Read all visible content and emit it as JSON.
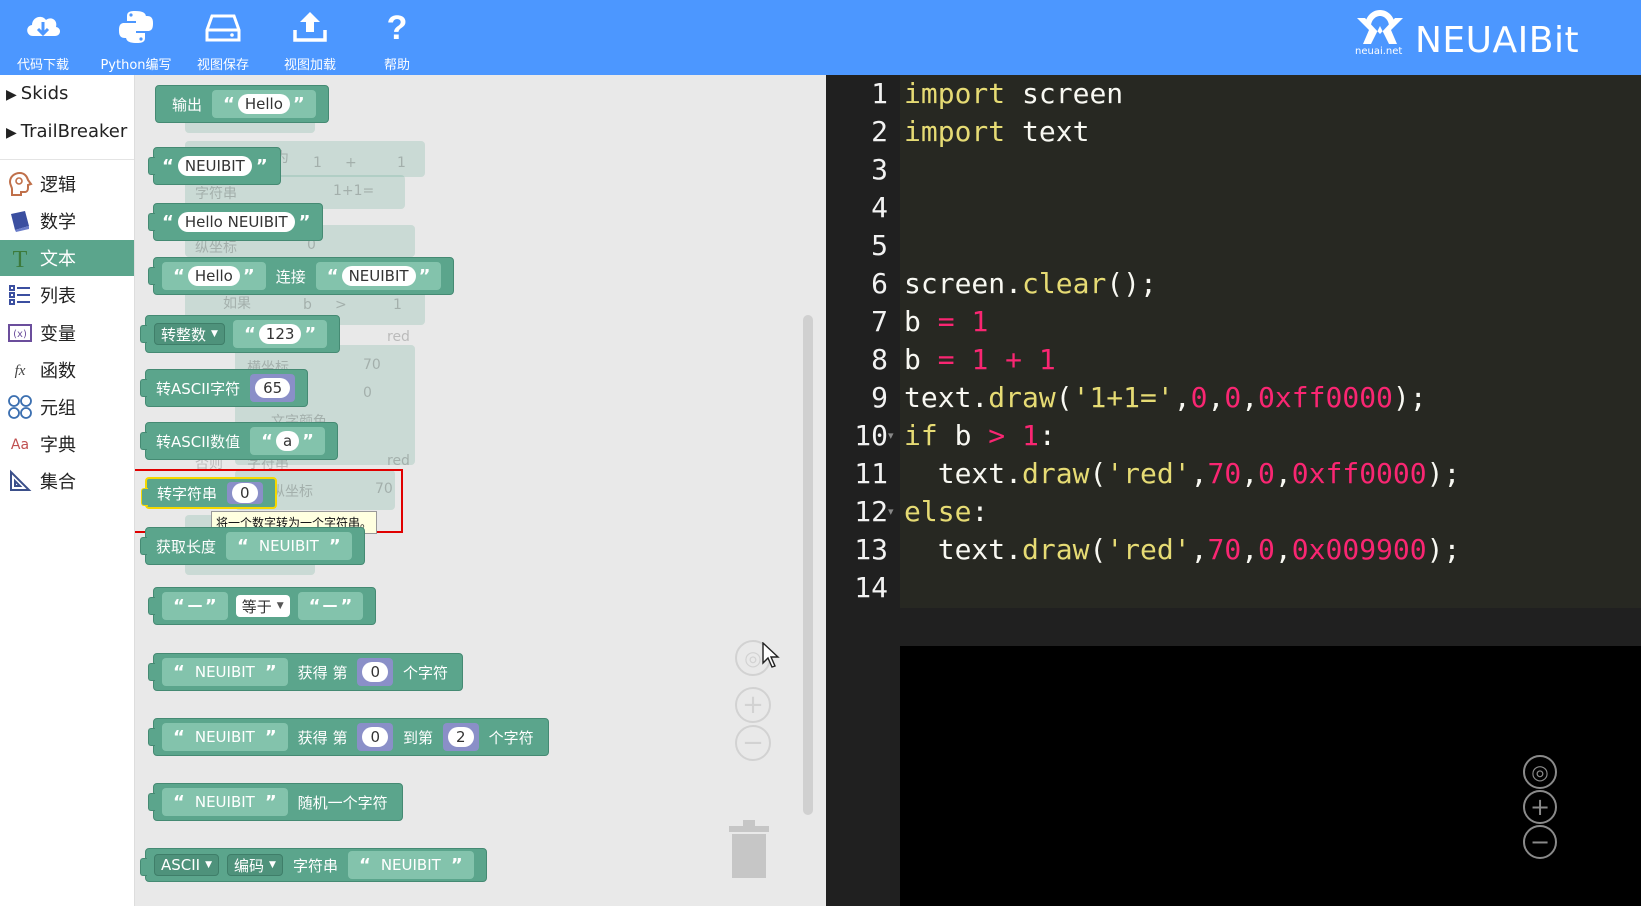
{
  "toolbar": {
    "buttons": [
      {
        "label": "代码下载",
        "icon": "cloud-download-icon"
      },
      {
        "label": "Python编写",
        "icon": "python-icon"
      },
      {
        "label": "视图保存",
        "icon": "drive-save-icon"
      },
      {
        "label": "视图加载",
        "icon": "upload-icon"
      },
      {
        "label": "帮助",
        "icon": "help-icon"
      }
    ],
    "brand_logo_text": "neuai.net",
    "brand_name": "NEUAIBit",
    "color": "#4c97ff"
  },
  "sidebar": {
    "extensions": [
      "Skids",
      "TrailBreaker"
    ],
    "categories": [
      {
        "label": "逻辑",
        "icon": "logic-head-icon",
        "active": false
      },
      {
        "label": "数学",
        "icon": "math-book-icon",
        "active": false
      },
      {
        "label": "文本",
        "icon": "text-t-icon",
        "active": true
      },
      {
        "label": "列表",
        "icon": "list-icon",
        "active": false
      },
      {
        "label": "变量",
        "icon": "variable-x-icon",
        "active": false
      },
      {
        "label": "函数",
        "icon": "function-fx-icon",
        "active": false
      },
      {
        "label": "元组",
        "icon": "tuple-circles-icon",
        "active": false
      },
      {
        "label": "字典",
        "icon": "dictionary-aa-icon",
        "active": false
      },
      {
        "label": "集合",
        "icon": "set-triangle-icon",
        "active": false
      }
    ],
    "active_color": "#5ba58c"
  },
  "flyout": {
    "print_block": {
      "label": "输出",
      "value": "Hello"
    },
    "str1": "NEUIBIT",
    "str2": "Hello NEUIBIT",
    "join": {
      "a": "Hello",
      "op": "连接",
      "b": "NEUIBIT"
    },
    "to_int": {
      "label": "转整数",
      "value": "123"
    },
    "to_ascii_char": {
      "label": "转ASCII字符",
      "value": "65"
    },
    "to_ascii_num": {
      "label": "转ASCII数值",
      "value": "a"
    },
    "to_str": {
      "label": "转字符串",
      "value": "0",
      "tooltip": "将一个数字转为一个字符串。"
    },
    "length": {
      "label": "获取长度",
      "value": "NEUIBIT"
    },
    "compare": {
      "op": "等于"
    },
    "char_at": {
      "s": "NEUIBIT",
      "l1": "获得 第",
      "n": "0",
      "l2": "个字符"
    },
    "substr": {
      "s": "NEUIBIT",
      "l1": "获得 第",
      "n1": "0",
      "l2": "到第",
      "n2": "2",
      "l3": "个字符"
    },
    "random_char": {
      "s": "NEUIBIT",
      "l": "随机一个字符"
    },
    "encode": {
      "enc": "ASCII",
      "op": "编码",
      "l": "字符串",
      "s": "NEUIBIT"
    },
    "ghost_labels": {
      "g1": "赋值为",
      "g2": "字符串",
      "g3": "1+1=",
      "g4": "纵坐标",
      "g5": "如果",
      "g6": "横坐标",
      "g7": "red",
      "g8": "文字颜色",
      "g9": "否则",
      "g10": "字符串",
      "g11": "纵坐标",
      "g12": "70",
      "g13": "1",
      "g14": "+",
      "g15": "1",
      "g16": "0",
      "g17": "b",
      "g18": ">",
      "g19": "1",
      "g20": "70",
      "g21": "0",
      "g22": "red"
    },
    "block_color": "#5ba58c"
  },
  "editor": {
    "line_numbers": [
      "1",
      "2",
      "3",
      "4",
      "5",
      "6",
      "7",
      "8",
      "9",
      "10",
      "11",
      "12",
      "13",
      "14"
    ]
  }
}
